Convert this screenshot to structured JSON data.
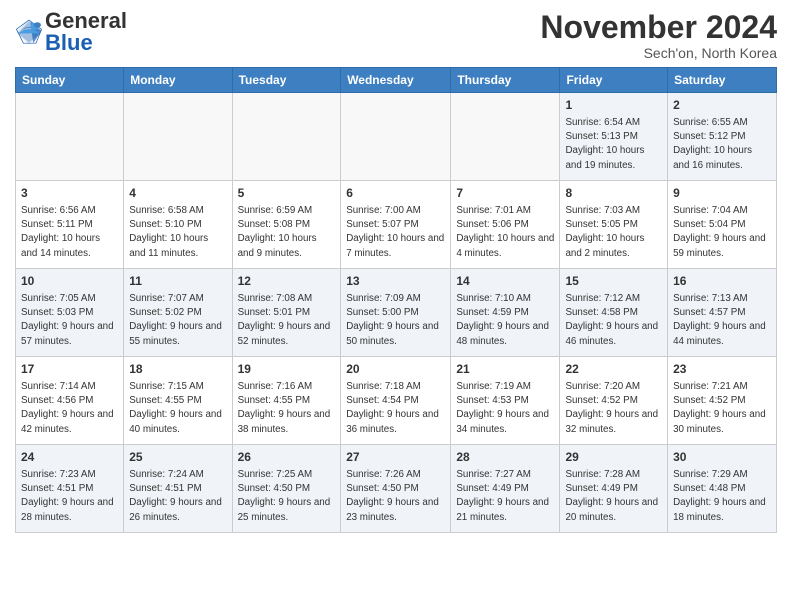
{
  "header": {
    "logo_text_general": "General",
    "logo_text_blue": "Blue",
    "month_title": "November 2024",
    "subtitle": "Sech'on, North Korea"
  },
  "days_of_week": [
    "Sunday",
    "Monday",
    "Tuesday",
    "Wednesday",
    "Thursday",
    "Friday",
    "Saturday"
  ],
  "weeks": [
    [
      {
        "day": "",
        "info": ""
      },
      {
        "day": "",
        "info": ""
      },
      {
        "day": "",
        "info": ""
      },
      {
        "day": "",
        "info": ""
      },
      {
        "day": "",
        "info": ""
      },
      {
        "day": "1",
        "info": "Sunrise: 6:54 AM\nSunset: 5:13 PM\nDaylight: 10 hours and 19 minutes."
      },
      {
        "day": "2",
        "info": "Sunrise: 6:55 AM\nSunset: 5:12 PM\nDaylight: 10 hours and 16 minutes."
      }
    ],
    [
      {
        "day": "3",
        "info": "Sunrise: 6:56 AM\nSunset: 5:11 PM\nDaylight: 10 hours and 14 minutes."
      },
      {
        "day": "4",
        "info": "Sunrise: 6:58 AM\nSunset: 5:10 PM\nDaylight: 10 hours and 11 minutes."
      },
      {
        "day": "5",
        "info": "Sunrise: 6:59 AM\nSunset: 5:08 PM\nDaylight: 10 hours and 9 minutes."
      },
      {
        "day": "6",
        "info": "Sunrise: 7:00 AM\nSunset: 5:07 PM\nDaylight: 10 hours and 7 minutes."
      },
      {
        "day": "7",
        "info": "Sunrise: 7:01 AM\nSunset: 5:06 PM\nDaylight: 10 hours and 4 minutes."
      },
      {
        "day": "8",
        "info": "Sunrise: 7:03 AM\nSunset: 5:05 PM\nDaylight: 10 hours and 2 minutes."
      },
      {
        "day": "9",
        "info": "Sunrise: 7:04 AM\nSunset: 5:04 PM\nDaylight: 9 hours and 59 minutes."
      }
    ],
    [
      {
        "day": "10",
        "info": "Sunrise: 7:05 AM\nSunset: 5:03 PM\nDaylight: 9 hours and 57 minutes."
      },
      {
        "day": "11",
        "info": "Sunrise: 7:07 AM\nSunset: 5:02 PM\nDaylight: 9 hours and 55 minutes."
      },
      {
        "day": "12",
        "info": "Sunrise: 7:08 AM\nSunset: 5:01 PM\nDaylight: 9 hours and 52 minutes."
      },
      {
        "day": "13",
        "info": "Sunrise: 7:09 AM\nSunset: 5:00 PM\nDaylight: 9 hours and 50 minutes."
      },
      {
        "day": "14",
        "info": "Sunrise: 7:10 AM\nSunset: 4:59 PM\nDaylight: 9 hours and 48 minutes."
      },
      {
        "day": "15",
        "info": "Sunrise: 7:12 AM\nSunset: 4:58 PM\nDaylight: 9 hours and 46 minutes."
      },
      {
        "day": "16",
        "info": "Sunrise: 7:13 AM\nSunset: 4:57 PM\nDaylight: 9 hours and 44 minutes."
      }
    ],
    [
      {
        "day": "17",
        "info": "Sunrise: 7:14 AM\nSunset: 4:56 PM\nDaylight: 9 hours and 42 minutes."
      },
      {
        "day": "18",
        "info": "Sunrise: 7:15 AM\nSunset: 4:55 PM\nDaylight: 9 hours and 40 minutes."
      },
      {
        "day": "19",
        "info": "Sunrise: 7:16 AM\nSunset: 4:55 PM\nDaylight: 9 hours and 38 minutes."
      },
      {
        "day": "20",
        "info": "Sunrise: 7:18 AM\nSunset: 4:54 PM\nDaylight: 9 hours and 36 minutes."
      },
      {
        "day": "21",
        "info": "Sunrise: 7:19 AM\nSunset: 4:53 PM\nDaylight: 9 hours and 34 minutes."
      },
      {
        "day": "22",
        "info": "Sunrise: 7:20 AM\nSunset: 4:52 PM\nDaylight: 9 hours and 32 minutes."
      },
      {
        "day": "23",
        "info": "Sunrise: 7:21 AM\nSunset: 4:52 PM\nDaylight: 9 hours and 30 minutes."
      }
    ],
    [
      {
        "day": "24",
        "info": "Sunrise: 7:23 AM\nSunset: 4:51 PM\nDaylight: 9 hours and 28 minutes."
      },
      {
        "day": "25",
        "info": "Sunrise: 7:24 AM\nSunset: 4:51 PM\nDaylight: 9 hours and 26 minutes."
      },
      {
        "day": "26",
        "info": "Sunrise: 7:25 AM\nSunset: 4:50 PM\nDaylight: 9 hours and 25 minutes."
      },
      {
        "day": "27",
        "info": "Sunrise: 7:26 AM\nSunset: 4:50 PM\nDaylight: 9 hours and 23 minutes."
      },
      {
        "day": "28",
        "info": "Sunrise: 7:27 AM\nSunset: 4:49 PM\nDaylight: 9 hours and 21 minutes."
      },
      {
        "day": "29",
        "info": "Sunrise: 7:28 AM\nSunset: 4:49 PM\nDaylight: 9 hours and 20 minutes."
      },
      {
        "day": "30",
        "info": "Sunrise: 7:29 AM\nSunset: 4:48 PM\nDaylight: 9 hours and 18 minutes."
      }
    ]
  ]
}
